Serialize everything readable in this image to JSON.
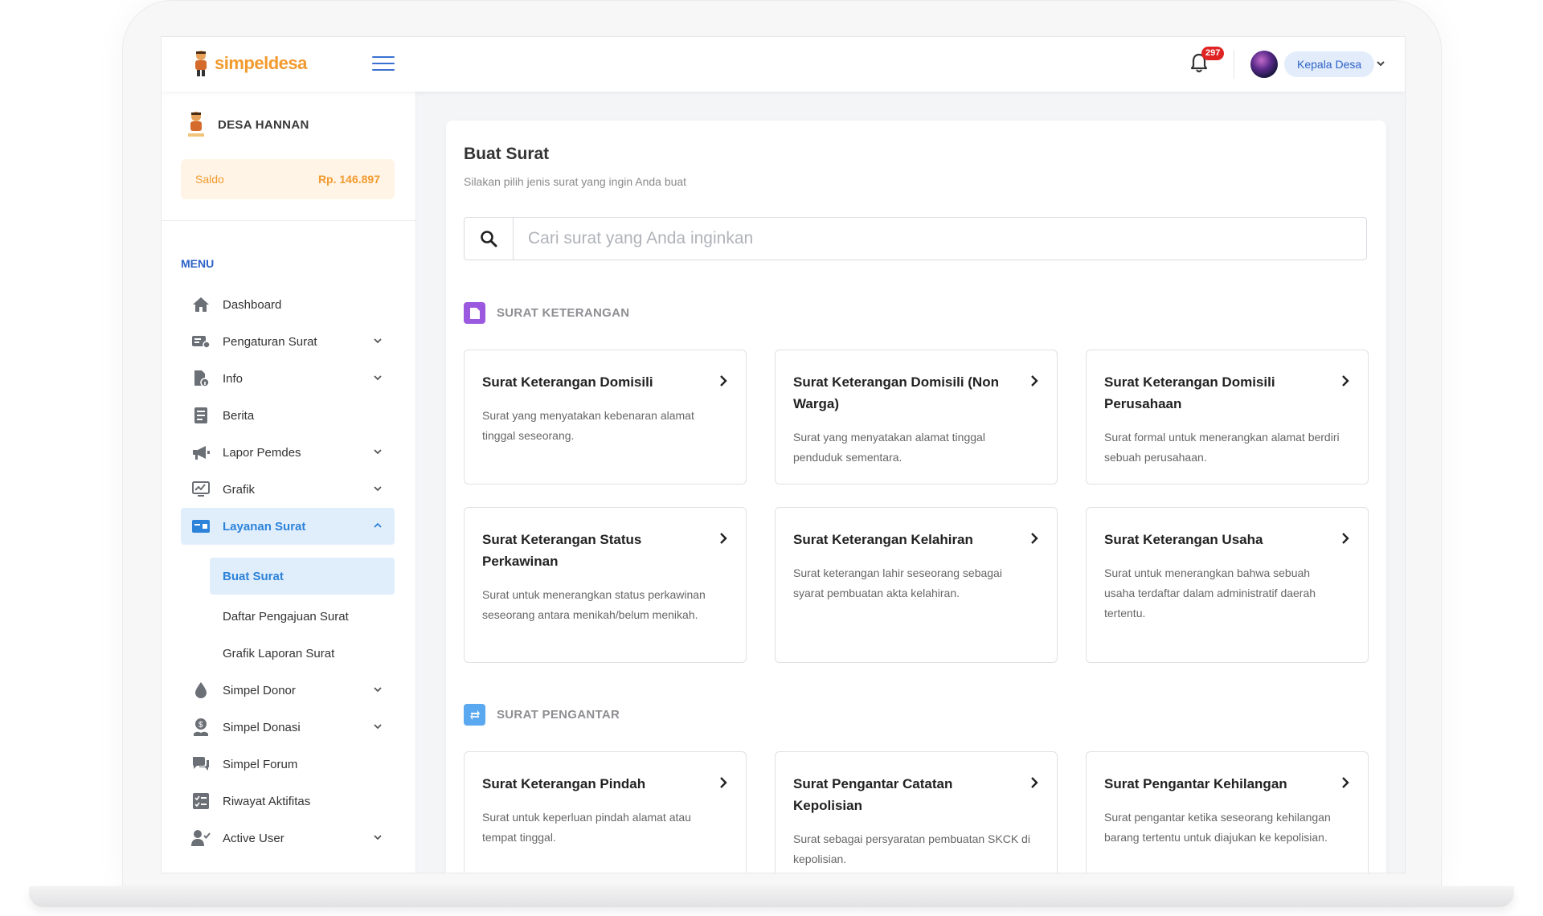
{
  "header": {
    "logo_text": "simpeldesa",
    "notification_count": "297",
    "user_role": "Kepala Desa"
  },
  "sidebar": {
    "village_name": "DESA HANNAN",
    "saldo_label": "Saldo",
    "saldo_value": "Rp. 146.897",
    "menu_title": "MENU",
    "items": [
      {
        "label": "Dashboard",
        "icon": "home-icon"
      },
      {
        "label": "Pengaturan Surat",
        "icon": "letter-settings-icon"
      },
      {
        "label": "Info",
        "icon": "info-doc-icon"
      },
      {
        "label": "Berita",
        "icon": "news-icon"
      },
      {
        "label": "Lapor Pemdes",
        "icon": "megaphone-icon"
      },
      {
        "label": "Grafik",
        "icon": "chart-monitor-icon"
      },
      {
        "label": "Layanan Surat",
        "icon": "card-icon"
      },
      {
        "label": "Simpel Donor",
        "icon": "drop-icon"
      },
      {
        "label": "Simpel Donasi",
        "icon": "donation-icon"
      },
      {
        "label": "Simpel Forum",
        "icon": "chat-icon"
      },
      {
        "label": "Riwayat Aktifitas",
        "icon": "checklist-icon"
      },
      {
        "label": "Active User",
        "icon": "user-check-icon"
      }
    ],
    "submenu": [
      {
        "label": "Buat Surat"
      },
      {
        "label": "Daftar Pengajuan Surat"
      },
      {
        "label": "Grafik Laporan Surat"
      }
    ]
  },
  "main": {
    "title": "Buat Surat",
    "subtitle": "Silakan pilih jenis surat yang ingin Anda buat",
    "search_placeholder": "Cari surat yang Anda inginkan",
    "sections": [
      {
        "label": "SURAT KETERANGAN",
        "color": "#9b59e0",
        "cards": [
          {
            "title": "Surat Keterangan Domisili",
            "desc": "Surat yang menyatakan kebenaran alamat tinggal seseorang."
          },
          {
            "title": "Surat Keterangan Domisili (Non Warga)",
            "desc": "Surat yang menyatakan alamat tinggal penduduk sementara."
          },
          {
            "title": "Surat Keterangan Domisili Perusahaan",
            "desc": "Surat formal untuk menerangkan alamat berdiri sebuah perusahaan."
          },
          {
            "title": "Surat Keterangan Status Perkawinan",
            "desc": "Surat untuk menerangkan status perkawinan seseorang antara menikah/belum menikah."
          },
          {
            "title": "Surat Keterangan Kelahiran",
            "desc": "Surat keterangan lahir seseorang sebagai syarat pembuatan akta kelahiran."
          },
          {
            "title": "Surat Keterangan Usaha",
            "desc": "Surat untuk menerangkan bahwa sebuah usaha terdaftar dalam administratif daerah tertentu."
          }
        ]
      },
      {
        "label": "SURAT PENGANTAR",
        "color": "#5aa9f0",
        "cards": [
          {
            "title": "Surat Keterangan Pindah",
            "desc": "Surat untuk keperluan pindah alamat atau tempat tinggal."
          },
          {
            "title": "Surat Pengantar Catatan Kepolisian",
            "desc": "Surat sebagai persyaratan pembuatan SKCK di kepolisian."
          },
          {
            "title": "Surat Pengantar Kehilangan",
            "desc": "Surat pengantar ketika seseorang kehilangan barang tertentu untuk diajukan ke kepolisian."
          }
        ]
      }
    ]
  }
}
